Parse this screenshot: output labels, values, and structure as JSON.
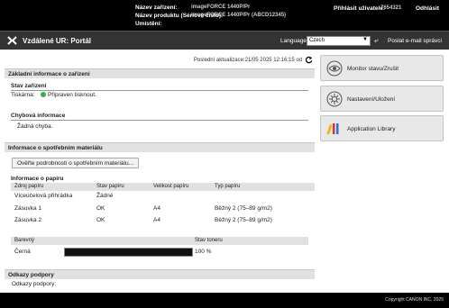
{
  "top": {
    "device_name_label": "Název zařízení:",
    "device_name_value": "imageFORCE 1440P/Pr",
    "product_name_label": "Název produktu (Sériové číslo):",
    "product_name_value": "imageFORCE 1440P/Pr (ABCD12345)",
    "location_label": "Umístění:",
    "user_label": "Přihlásit uživatele:",
    "user_value": "7654321",
    "logout": "Odhlásit"
  },
  "header": {
    "title": "Vzdálené UR: Portál",
    "language_label": "Language",
    "language_value": "Czech",
    "email_admin": "Poslat e-mail správci"
  },
  "main": {
    "last_update": "Poslední aktualizace:21/05 2025 12:16:15 od",
    "device_info": {
      "header": "Základní informace o zařízení",
      "status_header": "Stav zařízení",
      "printer_label": "Tiskárna:",
      "printer_status": "Připraven tisknout.",
      "error_header": "Chybová informace",
      "error_text": "Žádná chyba."
    },
    "consumables": {
      "header": "Informace o spotřebním materiálu",
      "check_button": "Ověřte podrobnosti o spotřebním materiálu...",
      "paper_header": "Informace o papíru",
      "paper_columns": [
        "Zdroj papíru",
        "Stav papíru",
        "Velikost papíru",
        "Typ papíru"
      ],
      "paper_rows": [
        [
          "Víceúčelová přihrádka",
          "Žádné",
          "",
          ""
        ],
        [
          "Zásuvka 1",
          "OK",
          "A4",
          "Běžný 2 (75–89 g/m2)"
        ],
        [
          "Zásuvka 2",
          "OK",
          "A4",
          "Běžný 2 (75–89 g/m2)"
        ]
      ],
      "toner_columns": [
        "Barevný",
        "",
        "Stav toneru"
      ],
      "toner_rows": [
        {
          "color": "Černá",
          "level_percent": 100,
          "status": "100 %"
        }
      ]
    },
    "support": {
      "header": "Odkazy podpory",
      "label": "Odkazy podpory:"
    },
    "copyright": "Copyright CANON INC. 2025"
  },
  "sidebar": {
    "items": [
      {
        "label": "Monitor stavu/Zrušit"
      },
      {
        "label": "Nastavení/Uložení"
      },
      {
        "label": "Application Library"
      }
    ]
  }
}
